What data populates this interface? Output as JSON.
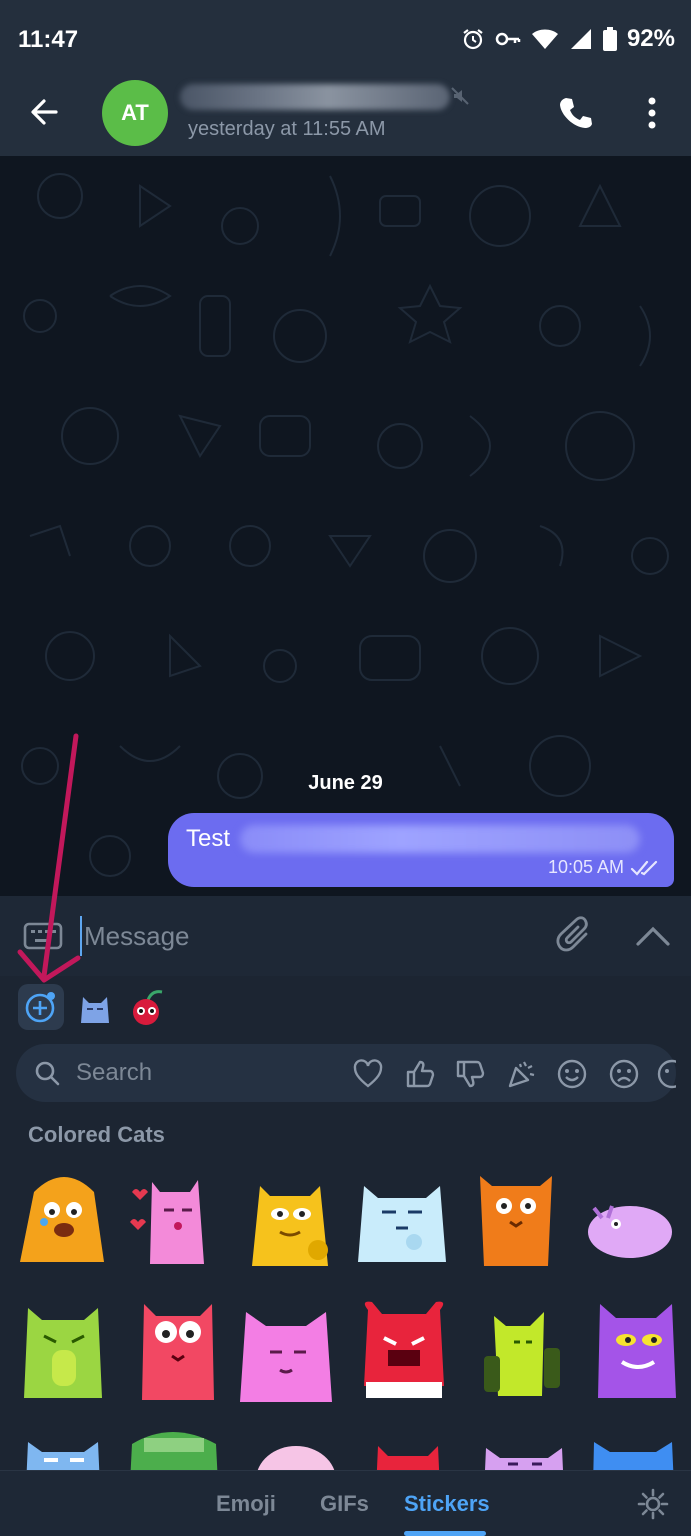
{
  "status_bar": {
    "time": "11:47",
    "battery": "92%"
  },
  "header": {
    "avatar_initials": "AT",
    "last_seen": "yesterday at 11:55 AM"
  },
  "chat": {
    "date": "June 29",
    "message": {
      "text": "Test",
      "time": "10:05 AM"
    }
  },
  "input": {
    "placeholder": "Message"
  },
  "panel": {
    "search_placeholder": "Search",
    "pack_title": "Colored Cats",
    "emoji_categories": [
      "heart-icon",
      "thumbs-up-icon",
      "thumbs-down-icon",
      "party-icon",
      "smile-icon",
      "sad-icon",
      "more-face-icon"
    ]
  },
  "tabs": {
    "emoji": "Emoji",
    "gifs": "GIFs",
    "stickers": "Stickers",
    "active": "Stickers"
  },
  "colors": {
    "accent": "#4ea4f6",
    "bubble": "#6c6cf0",
    "annotation_arrow": "#c2185b"
  }
}
